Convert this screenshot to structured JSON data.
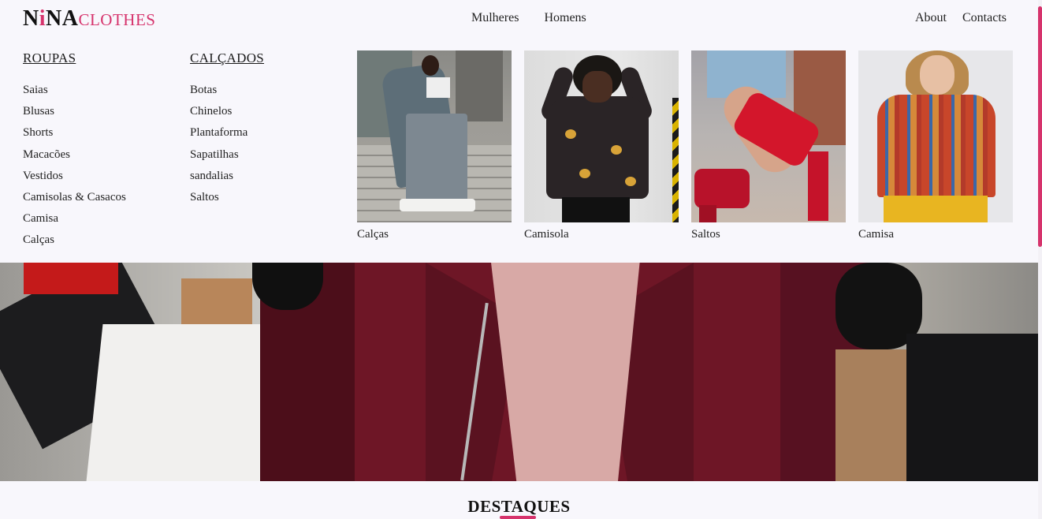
{
  "brand": {
    "nina_first": "N",
    "nina_i": "i",
    "nina_rest": "NA",
    "clothes": "CLOTHES"
  },
  "nav": {
    "center": [
      {
        "label": "Mulheres"
      },
      {
        "label": "Homens"
      }
    ],
    "right": [
      {
        "label": "About"
      },
      {
        "label": "Contacts"
      }
    ]
  },
  "menu": {
    "roupas": {
      "heading": "ROUPAS",
      "items": [
        "Saias",
        "Blusas",
        "Shorts",
        "Macacões",
        "Vestidos",
        "Camisolas & Casacos",
        "Camisa",
        "Calças"
      ]
    },
    "calcados": {
      "heading": "CALÇADOS",
      "items": [
        "Botas",
        "Chinelos",
        "Plantaforma",
        "Sapatilhas",
        "sandalias",
        "Saltos"
      ]
    }
  },
  "featured": [
    {
      "caption": "Calças"
    },
    {
      "caption": "Camisola"
    },
    {
      "caption": "Saltos"
    },
    {
      "caption": "Camisa"
    }
  ],
  "section": {
    "title": "DESTAQUES"
  },
  "colors": {
    "accent": "#d6336c",
    "background": "#f8f7fc"
  }
}
